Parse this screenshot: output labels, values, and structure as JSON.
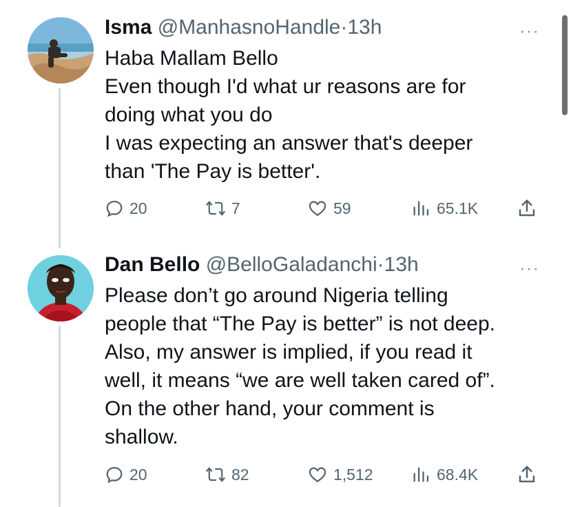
{
  "tweets": [
    {
      "name": "Isma",
      "handle": "@ManhasnoHandle",
      "separator": "·",
      "time": "13h",
      "lines": [
        "Haba Mallam Bello",
        "Even though I'd what ur reasons are for",
        "doing what you do",
        "I was expecting an answer that's deeper",
        "than 'The Pay is better'."
      ],
      "replies": "20",
      "retweets": "7",
      "likes": "59",
      "views": "65.1K"
    },
    {
      "name": "Dan Bello",
      "handle": "@BelloGaladanchi",
      "separator": "·",
      "time": "13h",
      "lines": [
        "Please don’t go around Nigeria telling",
        "people that “The Pay is better” is not deep.",
        "Also, my answer is implied, if you read it",
        "well, it means “we are well taken cared of”.",
        "On the other hand, your comment is",
        "shallow."
      ],
      "replies": "20",
      "retweets": "82",
      "likes": "1,512",
      "views": "68.4K"
    }
  ],
  "more_label": "···",
  "colors": {
    "text": "#0f1419",
    "secondary": "#536471",
    "thread_line": "#cfd9de",
    "avatar_bg_2": "#6fd0e0"
  },
  "icons": [
    "reply-icon",
    "retweet-icon",
    "like-icon",
    "views-icon",
    "share-icon",
    "more-icon"
  ]
}
